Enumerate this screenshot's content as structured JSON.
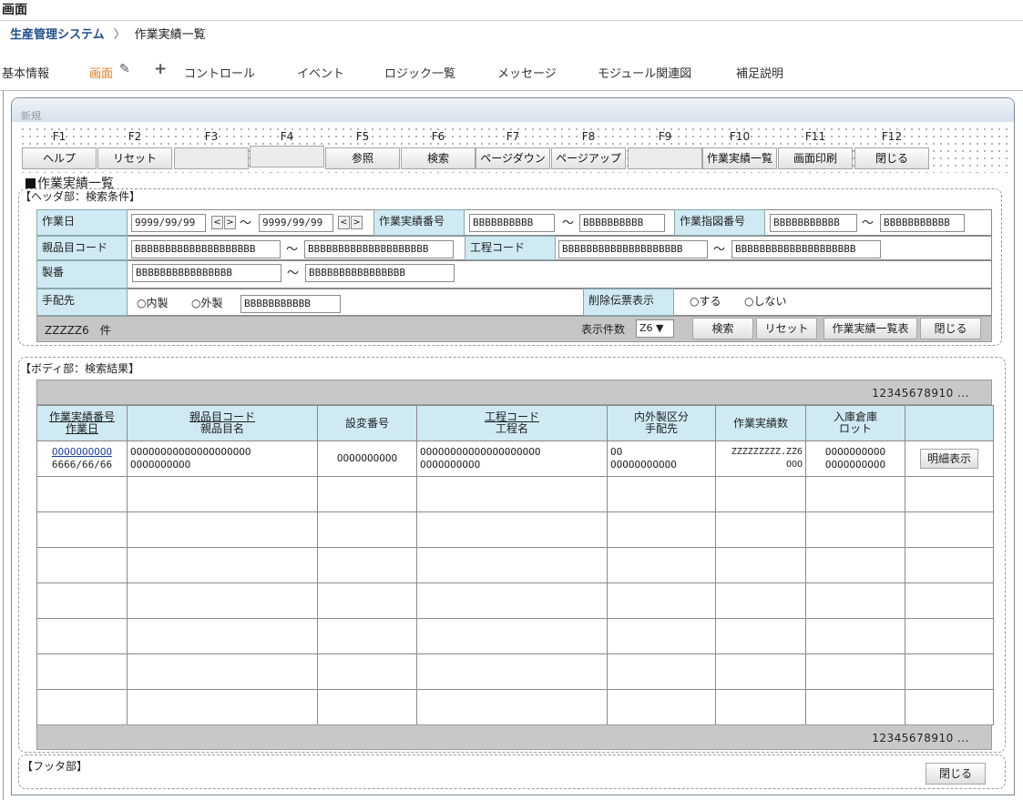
{
  "page_title": "画面",
  "breadcrumb": {
    "system": "生産管理システム",
    "sep": "〉",
    "current": "作業実績一覧"
  },
  "tabs": {
    "basic": "基本情報",
    "screen": "画面",
    "control": "コントロール",
    "event": "イベント",
    "logic": "ロジック一覧",
    "message": "メッセージ",
    "module": "モジュール関連図",
    "supplement": "補足説明"
  },
  "frame_title": "新規",
  "fkeys": [
    {
      "key": "F1",
      "label": "ヘルプ"
    },
    {
      "key": "F2",
      "label": "リセット"
    },
    {
      "key": "F3",
      "label": ""
    },
    {
      "key": "F4",
      "label": ""
    },
    {
      "key": "F5",
      "label": "参照"
    },
    {
      "key": "F6",
      "label": "検索"
    },
    {
      "key": "F7",
      "label": "ページダウン"
    },
    {
      "key": "F8",
      "label": "ページアップ"
    },
    {
      "key": "F9",
      "label": ""
    },
    {
      "key": "F10",
      "label": "作業実績一覧"
    },
    {
      "key": "F11",
      "label": "画面印刷"
    },
    {
      "key": "F12",
      "label": "閉じる"
    }
  ],
  "section_title": "作業実績一覧",
  "header": {
    "label": "【ヘッダ部：検索条件】",
    "work_date_label": "作業日",
    "date_from": "9999/99/99",
    "date_to": "9999/99/99",
    "tilde": "～",
    "prev": "<",
    "next": ">",
    "result_no_label": "作業実績番号",
    "result_no_from": "BBBBBBBBBB",
    "result_no_to": "BBBBBBBBBB",
    "order_no_label": "作業指図番号",
    "order_no_from": "BBBBBBBBBBB",
    "order_no_to": "BBBBBBBBBBB",
    "parent_code_label": "親品目コード",
    "parent_code_from": "BBBBBBBBBBBBBBBBBBBB",
    "parent_code_to": "BBBBBBBBBBBBBBBBBBBB",
    "process_code_label": "工程コード",
    "process_code_from": "BBBBBBBBBBBBBBBBBBBB",
    "process_code_to": "BBBBBBBBBBBBBBBBBBBB",
    "seiban_label": "製番",
    "seiban_from": "BBBBBBBBBBBBBBBB",
    "seiban_to": "BBBBBBBBBBBBBBBB",
    "supplier_label": "手配先",
    "radio_internal": "○内製",
    "radio_external": "○外製",
    "supplier_value": "BBBBBBBBBBB",
    "deleted_label": "削除伝票表示",
    "radio_show": "○する",
    "radio_hide": "○しない",
    "count_text": "ZZZZZ6　件",
    "display_count_label": "表示件数",
    "display_count_value": "Z6 ▼",
    "search_button": "検索",
    "reset_button": "リセット",
    "list_button": "作業実績一覧表",
    "close_button": "閉じる"
  },
  "body": {
    "label": "【ボディ部：検索結果】",
    "pager": "12345678910 ...",
    "columns": {
      "c1a": "作業実績番号",
      "c1b": "作業日",
      "c2a": "親品目コード",
      "c2b": "親品目名",
      "c3": "設変番号",
      "c4a": "工程コード",
      "c4b": "工程名",
      "c5a": "内外製区分",
      "c5b": "手配先",
      "c6": "作業実績数",
      "c7a": "入庫倉庫",
      "c7b": "ロット"
    },
    "row": {
      "c1a": "OOOOOOOOOO",
      "c1b": "6666/66/66",
      "c2a": "OOOOOOOOOOOOOOOOOOOO",
      "c2b": "OOOOOOOOOO",
      "c3": "OOOOOOOOOO",
      "c4a": "OOOOOOOOOOOOOOOOOOOO",
      "c4b": "OOOOOOOOOO",
      "c5a": "OO",
      "c5b": "OOOOOOOOOOO",
      "c6a": "ZZZZZZZZZ.ZZ6",
      "c6b": "OOO",
      "c7a": "OOOOOOOOOO",
      "c7b": "OOOOOOOOOO",
      "detail_button": "明細表示"
    }
  },
  "footer": {
    "label": "【フッタ部】",
    "close_button": "閉じる"
  }
}
